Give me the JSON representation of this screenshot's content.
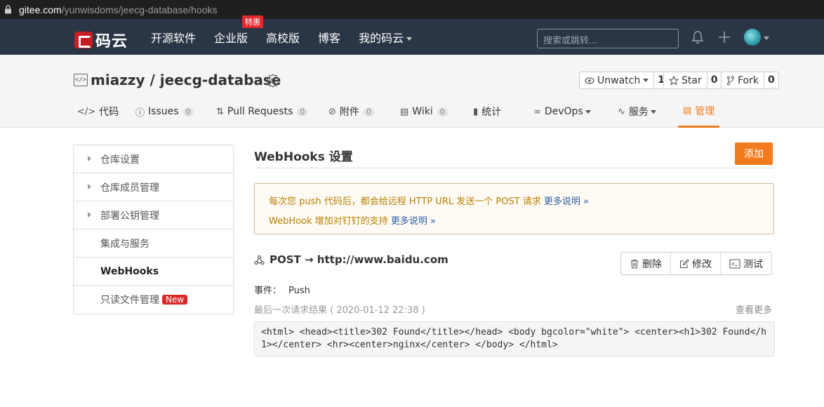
{
  "browser": {
    "url_host": "gitee.com",
    "url_path": "/yunwisdoms/jeecg-database/hooks"
  },
  "topnav": {
    "logo_text": "码云",
    "links": [
      "开源软件",
      "企业版",
      "高校版",
      "博客",
      "我的码云"
    ],
    "promo_badge": "特惠",
    "search_placeholder": "搜索或跳转..."
  },
  "repo": {
    "title": "miazzy / jeecg-database",
    "icon_text": "</>",
    "unwatch": {
      "label": "Unwatch",
      "count": "1"
    },
    "star": {
      "label": "Star",
      "count": "0"
    },
    "fork": {
      "label": "Fork",
      "count": "0"
    },
    "tabs": [
      {
        "label": "代码",
        "icon": "</>"
      },
      {
        "label": "Issues",
        "count": "0",
        "icon": "ⓘ"
      },
      {
        "label": "Pull Requests",
        "count": "0",
        "icon": "⇅"
      },
      {
        "label": "附件",
        "count": "0",
        "icon": "⊘"
      },
      {
        "label": "Wiki",
        "count": "0",
        "icon": "▤"
      },
      {
        "label": "统计",
        "icon": "▮"
      },
      {
        "label": "DevOps",
        "icon": "∞"
      },
      {
        "label": "服务",
        "icon": "∿"
      },
      {
        "label": "管理",
        "icon": "▤"
      }
    ]
  },
  "sidebar": {
    "items": [
      "仓库设置",
      "仓库成员管理",
      "部署公钥管理",
      "集成与服务",
      "WebHooks",
      "只读文件管理"
    ],
    "new_tag": "New"
  },
  "main": {
    "title": "WebHooks 设置",
    "add_button": "添加",
    "notice_line1": "每次您 push 代码后，都会给远程 HTTP URL 发送一个 POST 请求",
    "notice_line2": "WebHook 增加对钉钉的支持",
    "more_link": "更多说明 »",
    "hook_title": "POST → http://www.baidu.com",
    "delete_label": "删除",
    "edit_label": "修改",
    "test_label": "测试",
    "event_label": "事件：",
    "event_value": "Push",
    "last_request": "最后一次请求结果 ( 2020-01-12 22:38 )",
    "view_more": "查看更多",
    "response_body": "<html> <head><title>302 Found</title></head> <body bgcolor=\"white\"> <center><h1>302 Found</h1></center> <hr><center>nginx</center> </body> </html>"
  },
  "colors": {
    "accent": "#f37b1d",
    "nav_bg": "#2a3546",
    "brand_red": "#c71d23"
  }
}
